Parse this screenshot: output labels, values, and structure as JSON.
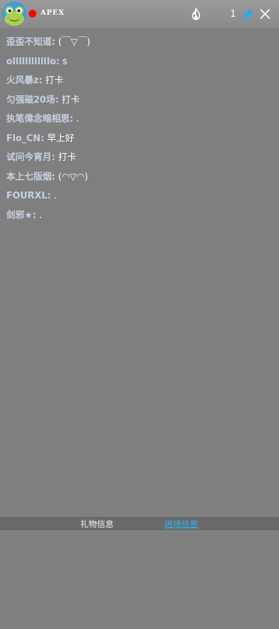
{
  "header": {
    "room_name": "APEX",
    "viewer_count": "1",
    "icons": {
      "avatar": "frog-avatar",
      "live": "red-dot-icon",
      "popularity": "fire-icon",
      "pin": "pin-icon",
      "close": "close-icon"
    }
  },
  "chat": {
    "messages": [
      {
        "user": "歪歪不知道:",
        "text": " (￣▽￣)"
      },
      {
        "user": "ollllllllllllo:",
        "text": " s"
      },
      {
        "user": "火风暴z:",
        "text": " 打卡"
      },
      {
        "user": "匀强磁20场:",
        "text": " 打卡"
      },
      {
        "user": "执笔偉念暗相思:",
        "text": " ."
      },
      {
        "user": "Flo_CN:",
        "text": " 早上好"
      },
      {
        "user": "试问今宵月:",
        "text": " 打卡"
      },
      {
        "user": "本上七版烟:",
        "text": " (◠▽◠)"
      },
      {
        "user": "FOURXL:",
        "text": " ."
      },
      {
        "user": "剑邪★:",
        "text": " ."
      }
    ]
  },
  "tabs": {
    "gift_label": "礼物信息",
    "enter_label": "进场信息"
  },
  "colors": {
    "background": "#7f7f7f",
    "username": "#c6d1e3",
    "message": "#ffffff",
    "active_tab": "#29b6f6",
    "live_dot": "#ff0000"
  }
}
